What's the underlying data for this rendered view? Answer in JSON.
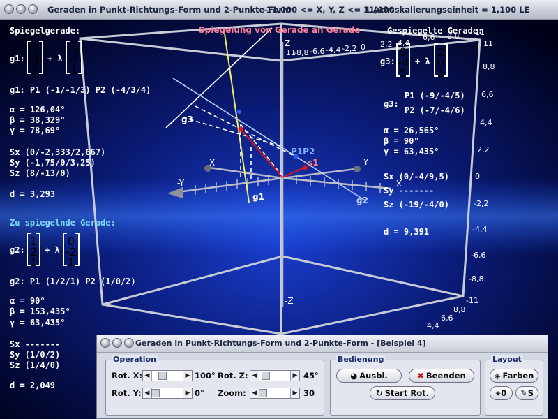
{
  "window": {
    "title": "Geraden in Punkt-Richtungs-Form und 2-Punkte-Form",
    "range": "-11,000 <= X, Y, Z <= 11,000",
    "scale": "1 Achsskalierungseinheit = 1,100 LE"
  },
  "plot_title": "Spiegelung von Gerade an Gerade",
  "left": {
    "section1": "Spiegelgerade:",
    "g1_label": "g1:",
    "g1_point": [
      "-1",
      "-1",
      "3"
    ],
    "g1_dir": [
      "-3",
      "4",
      "1"
    ],
    "plus_lambda": "+ λ",
    "g1_points": "g1: P1 (-1/-1/3)   P2 (-4/3/4)",
    "g1_alpha": "α = 126,04°",
    "g1_beta": "β = 38,329°",
    "g1_gamma": "γ = 78,69°",
    "g1_sx": "Sx (0/-2,333/2,667)",
    "g1_sy": "Sy (-1,75/0/3,25)",
    "g1_sz": "Sz (8/-13/0)",
    "g1_d": "d = 3,293",
    "section2": "Zu spiegelnde Gerade:",
    "g2_label": "g2:",
    "g2_point": [
      "1",
      "2",
      "1"
    ],
    "g2_dir": [
      "0",
      "-2",
      "1"
    ],
    "g2_points": "g2: P1 (1/2/1)    P2 (1/0/2)",
    "g2_alpha": "α = 90°",
    "g2_beta": "β = 153,435°",
    "g2_gamma": "γ =  63,435°",
    "g2_sx": "Sx -------",
    "g2_sy": "Sy (1/0/2)",
    "g2_sz": "Sz (1/4/0)",
    "g2_d": "d = 2,049"
  },
  "right": {
    "section": "Gespiegelte Gerade:",
    "g3_label": "g3:",
    "g3_point": [
      "9",
      "-4",
      "5"
    ],
    "g3_dir": [
      "2",
      "0",
      "1"
    ],
    "g3_p1_label": "g3:",
    "g3_p1": "P1 (-9/-4/5)",
    "g3_p2": "P2 (-7/-4/6)",
    "g3_alpha": "α = 26,565°",
    "g3_beta": "β = 90°",
    "g3_gamma": "γ = 63,435°",
    "g3_sx": "Sx (0/-4/9,5)",
    "g3_sy": "Sy -------",
    "g3_sz": "Sz (-19/-4/0)",
    "g3_d": "d = 9,391"
  },
  "plot_labels": {
    "g1": "g1",
    "g2": "g2",
    "g3": "g3",
    "s1": "s1",
    "p1p2": "P1P2",
    "x": "X",
    "x_neg": "-X",
    "y": "Y",
    "y_neg": "-Y",
    "z": "Z",
    "z_neg": "-Z"
  },
  "axis_numbers": {
    "top": [
      "-8,8",
      "-6,6",
      "-4,4",
      "-2,2",
      "0",
      "2,2",
      "4,4",
      "6,6",
      "8,8",
      "11"
    ],
    "top_left": "11",
    "right": [
      "11",
      "8,8",
      "6,6",
      "4,4",
      "2,2",
      "0",
      "-2,2",
      "-4,4",
      "-6,6",
      "-8,8",
      "-11"
    ],
    "bottom": [
      "8,8",
      "6,6",
      "4,4"
    ]
  },
  "dialog": {
    "title": "Geraden in Punkt-Richtungs-Form und 2-Punkte-Form - [Beispiel 4]",
    "operation": {
      "label": "Operation",
      "rot_x_label": "Rot. X:",
      "rot_x_value": "100°",
      "rot_x_level": 0.28,
      "rot_y_label": "Rot. Y:",
      "rot_y_value": "0°",
      "rot_y_level": 0.0,
      "rot_z_label": "Rot. Z:",
      "rot_z_value": "45°",
      "rot_z_level": 0.12,
      "zoom_label": "Zoom:",
      "zoom_value": "30",
      "zoom_level": 0.0
    },
    "bedienung": {
      "label": "Bedienung",
      "ausbl": "Ausbl.",
      "beenden": "Beenden",
      "start_rot": "Start Rot."
    },
    "layout": {
      "label": "Layout",
      "farben": "Farben",
      "zero": "0",
      "s": "S"
    }
  }
}
